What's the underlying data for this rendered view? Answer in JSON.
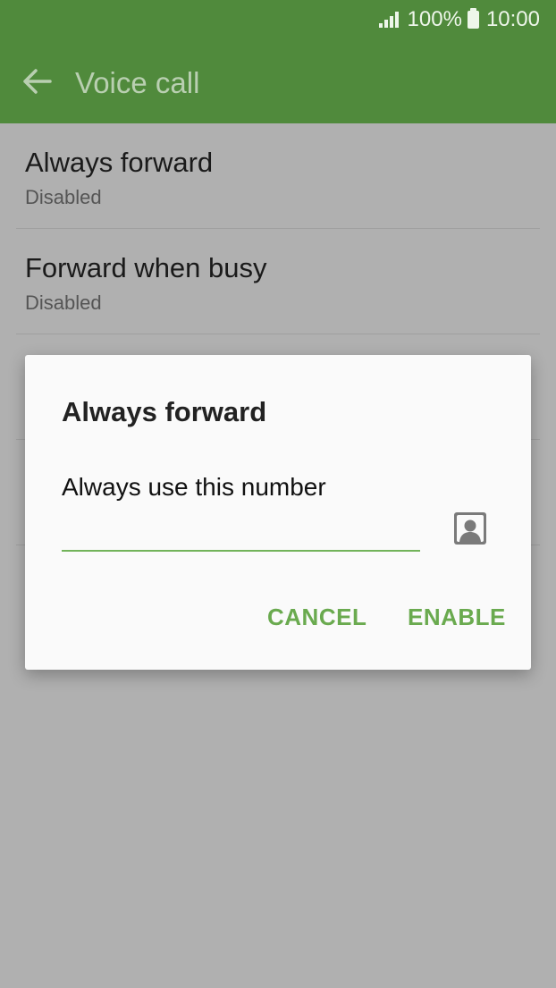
{
  "status_bar": {
    "battery": "100%",
    "time": "10:00"
  },
  "app_bar": {
    "title": "Voice call",
    "back_icon": "arrow-left-icon"
  },
  "list": {
    "items": [
      {
        "title": "Always forward",
        "subtitle": "Disabled"
      },
      {
        "title": "Forward when busy",
        "subtitle": "Disabled"
      },
      {
        "title": "",
        "subtitle": ""
      },
      {
        "title": "",
        "subtitle": ""
      }
    ]
  },
  "dialog": {
    "title": "Always forward",
    "label": "Always use this number",
    "input_value": "",
    "contact_icon": "contact-person-icon",
    "cancel_label": "CANCEL",
    "enable_label": "ENABLE"
  },
  "colors": {
    "app_bar": "#508a3c",
    "accent": "#6aaa4f",
    "scrim": "#b0b0b0"
  }
}
